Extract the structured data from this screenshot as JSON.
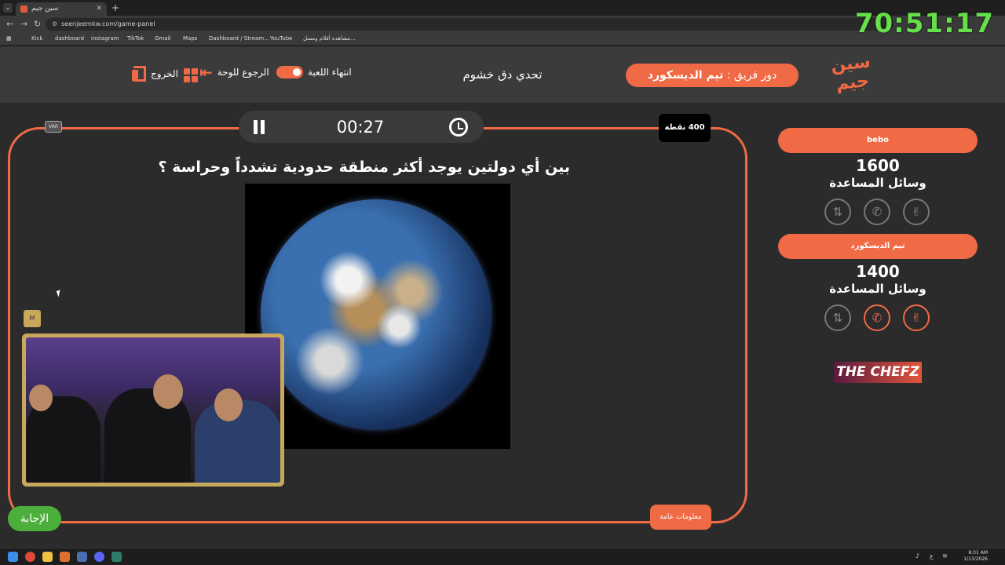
{
  "browser": {
    "tab_title": "سين جيم",
    "new_tab": "+",
    "url": "seenjeemkw.com/game-panel",
    "bookmarks": [
      {
        "label": "Kick",
        "color": "#53fc18"
      },
      {
        "label": "dashboard",
        "color": "#53fc18"
      },
      {
        "label": "instagram",
        "color": "#d6249f"
      },
      {
        "label": "TikTok",
        "color": "#222222"
      },
      {
        "label": "Gmail",
        "color": "#ea4335"
      },
      {
        "label": "Maps",
        "color": "#34a853"
      },
      {
        "label": "Dashboard / Stream...",
        "color": "#5ab0a0"
      },
      {
        "label": "YouTube",
        "color": "#ff0000"
      },
      {
        "label": "مشاهدة أفلام ومسل...",
        "color": "#444444"
      }
    ]
  },
  "overlay": {
    "stream_timer": "70:51:17"
  },
  "header": {
    "logo_text": "سين جيم",
    "turn_prefix": "دور فريق :",
    "turn_team": "تيم الديسكورد",
    "game_title": "تحدي دق خشوم",
    "end_game_label": "انتهاء اللعبة",
    "back_to_board_label": "الرجوع للوحة",
    "exit_label": "الخروج"
  },
  "question_panel": {
    "timer": "00:27",
    "points": "400 نقطة",
    "var_label": "VAR",
    "question_text": "بين أي دولتين يوجد أكثر منطقة حدودية تشدداً وحراسة ؟",
    "general_info_label": "معلومات عامة",
    "answer_label": "الإجابة"
  },
  "teams": [
    {
      "name": "bebo",
      "score": "1600",
      "aids_label": "وسائل المساعدة",
      "aids": [
        {
          "icon": "swap-icon",
          "active": false
        },
        {
          "icon": "phone-icon",
          "active": false
        },
        {
          "icon": "peace-hand-icon",
          "active": false
        }
      ]
    },
    {
      "name": "تيم الديسكورد",
      "score": "1400",
      "aids_label": "وسائل المساعدة",
      "aids": [
        {
          "icon": "swap-icon",
          "active": false
        },
        {
          "icon": "phone-icon",
          "active": true
        },
        {
          "icon": "peace-hand-icon",
          "active": true
        }
      ]
    }
  ],
  "sponsor": "THE CHEFZ",
  "taskbar": {
    "time": "8:31 AM",
    "date": "1/13/2026",
    "lang": "ع"
  },
  "colors": {
    "accent": "#ef6a45",
    "answer": "#4caf3c",
    "background": "#2b2b2b",
    "timer_overlay": "#66e04a"
  }
}
